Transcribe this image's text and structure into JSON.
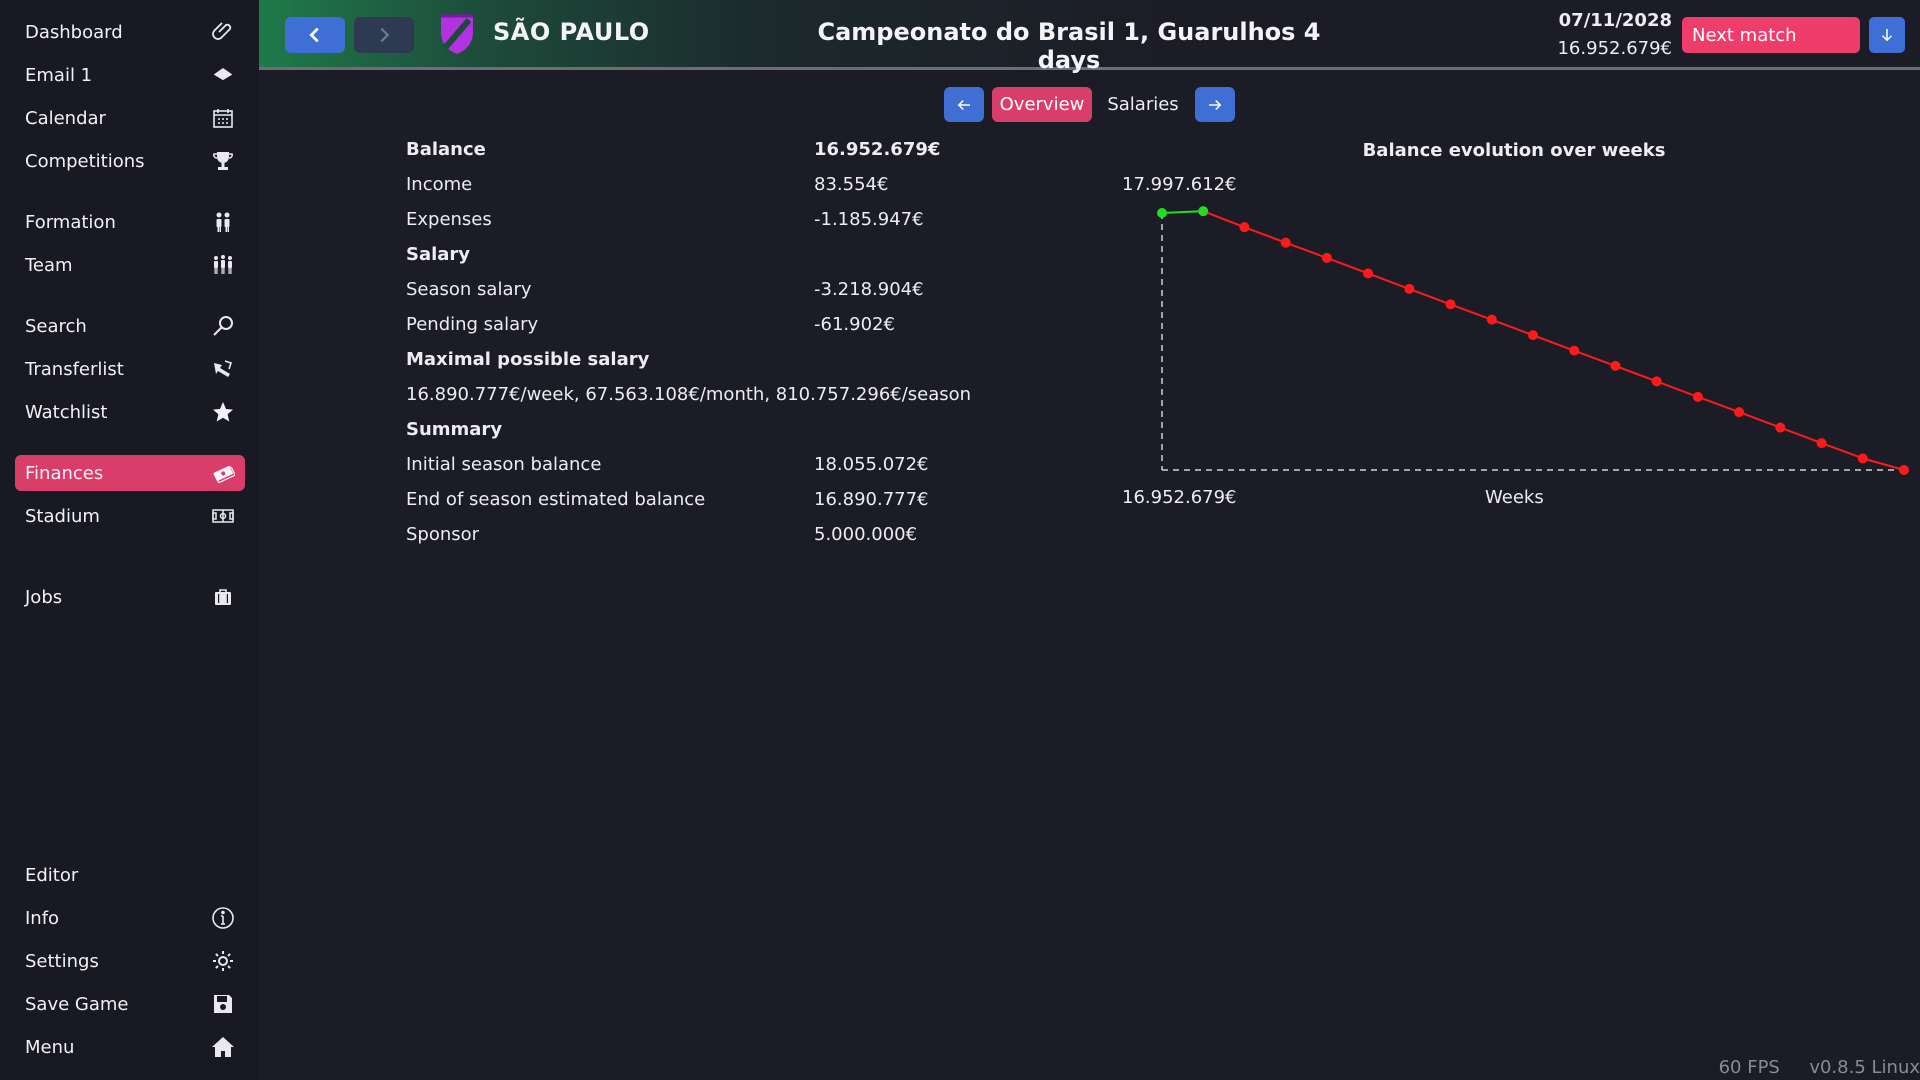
{
  "sidebar": {
    "items": [
      {
        "label": "Dashboard",
        "icon": "paperclip-icon"
      },
      {
        "label": "Email 1",
        "icon": "email-icon"
      },
      {
        "label": "Calendar",
        "icon": "calendar-icon"
      },
      {
        "label": "Competitions",
        "icon": "trophy-icon"
      },
      {
        "label": "Formation",
        "icon": "formation-icon"
      },
      {
        "label": "Team",
        "icon": "team-icon"
      },
      {
        "label": "Search",
        "icon": "search-icon"
      },
      {
        "label": "Transferlist",
        "icon": "transfer-icon"
      },
      {
        "label": "Watchlist",
        "icon": "star-icon"
      },
      {
        "label": "Finances",
        "icon": "money-icon"
      },
      {
        "label": "Stadium",
        "icon": "stadium-icon"
      },
      {
        "label": "Jobs",
        "icon": "briefcase-icon"
      },
      {
        "label": "Editor",
        "icon": ""
      },
      {
        "label": "Info",
        "icon": "info-icon"
      },
      {
        "label": "Settings",
        "icon": "gear-icon"
      },
      {
        "label": "Save Game",
        "icon": "save-icon"
      },
      {
        "label": "Menu",
        "icon": "home-icon"
      }
    ],
    "active": "Finances"
  },
  "header": {
    "team_name": "SÃO PAULO",
    "competition": "Campeonato do Brasil 1, Guarulhos 4 days",
    "date": "07/11/2028",
    "balance": "16.952.679€",
    "next_match_label": "Next match"
  },
  "tabs": {
    "overview": "Overview",
    "salaries": "Salaries",
    "active": "Overview"
  },
  "finances": {
    "balance_label": "Balance",
    "balance_value": "16.952.679€",
    "income_label": "Income",
    "income_value": "83.554€",
    "expenses_label": "Expenses",
    "expenses_value": "-1.185.947€",
    "salary_heading": "Salary",
    "season_salary_label": "Season salary",
    "season_salary_value": "-3.218.904€",
    "pending_salary_label": "Pending salary",
    "pending_salary_value": "-61.902€",
    "max_salary_heading": "Maximal possible salary",
    "max_salary_value": "16.890.777€/week, 67.563.108€/month, 810.757.296€/season",
    "summary_heading": "Summary",
    "initial_balance_label": "Initial season balance",
    "initial_balance_value": "18.055.072€",
    "end_balance_label": "End of season estimated balance",
    "end_balance_value": "16.890.777€",
    "sponsor_label": "Sponsor",
    "sponsor_value": "5.000.000€"
  },
  "chart_data": {
    "type": "line",
    "title": "Balance evolution over weeks",
    "xlabel": "Weeks",
    "ylabel": "",
    "y_max_label": "17.997.612€",
    "y_min_label": "16.952.679€",
    "ylim": [
      16952679,
      17997612
    ],
    "series": [
      {
        "color_past": "#22dd22",
        "color_future": "#ff1a1a",
        "past_count": 2,
        "values": [
          17997612,
          18005000,
          17940000,
          17877000,
          17815000,
          17752000,
          17689000,
          17626000,
          17564000,
          17501000,
          17438000,
          17376000,
          17313000,
          17250000,
          17188000,
          17125000,
          17062000,
          17000000,
          16952679
        ]
      }
    ],
    "grid": false
  },
  "footer": {
    "fps": "60 FPS",
    "version": "v0.8.5 Linux"
  },
  "colors": {
    "accent_active": "#d93e6a",
    "button_blue": "#3f6fd4",
    "next_match": "#ef3d6b",
    "background": "#1c1c26"
  }
}
